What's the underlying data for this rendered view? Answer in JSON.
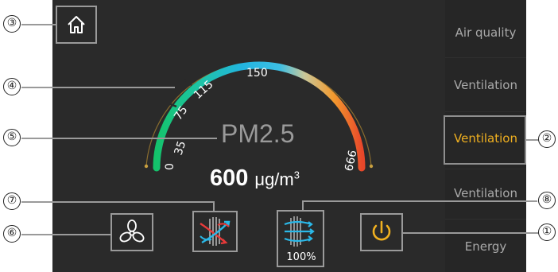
{
  "sidebar": {
    "items": [
      {
        "label": "Air quality"
      },
      {
        "label": "Ventilation"
      },
      {
        "label": "Ventilation"
      },
      {
        "label": "Ventilation"
      },
      {
        "label": "Energy"
      }
    ]
  },
  "gauge": {
    "label": "PM2.5",
    "value": "600",
    "unit": "μg/m",
    "unit_exp": "3",
    "ticks": [
      "0",
      "35",
      "75",
      "115",
      "150",
      "666"
    ]
  },
  "filter": {
    "percent_label": "100%"
  },
  "callouts": [
    "①",
    "②",
    "③",
    "④",
    "⑤",
    "⑥",
    "⑦",
    "⑧"
  ],
  "icons": {
    "home": "home-icon",
    "fan": "fan-icon",
    "heat_exchange": "heat-exchange-icon",
    "filter": "filter-icon",
    "power": "power-icon"
  },
  "colors": {
    "background": "#2a2a2a",
    "accent": "#f0b020",
    "gauge_start": "#14c36a",
    "gauge_mid": "#22b4e0",
    "gauge_end": "#e8472a"
  }
}
